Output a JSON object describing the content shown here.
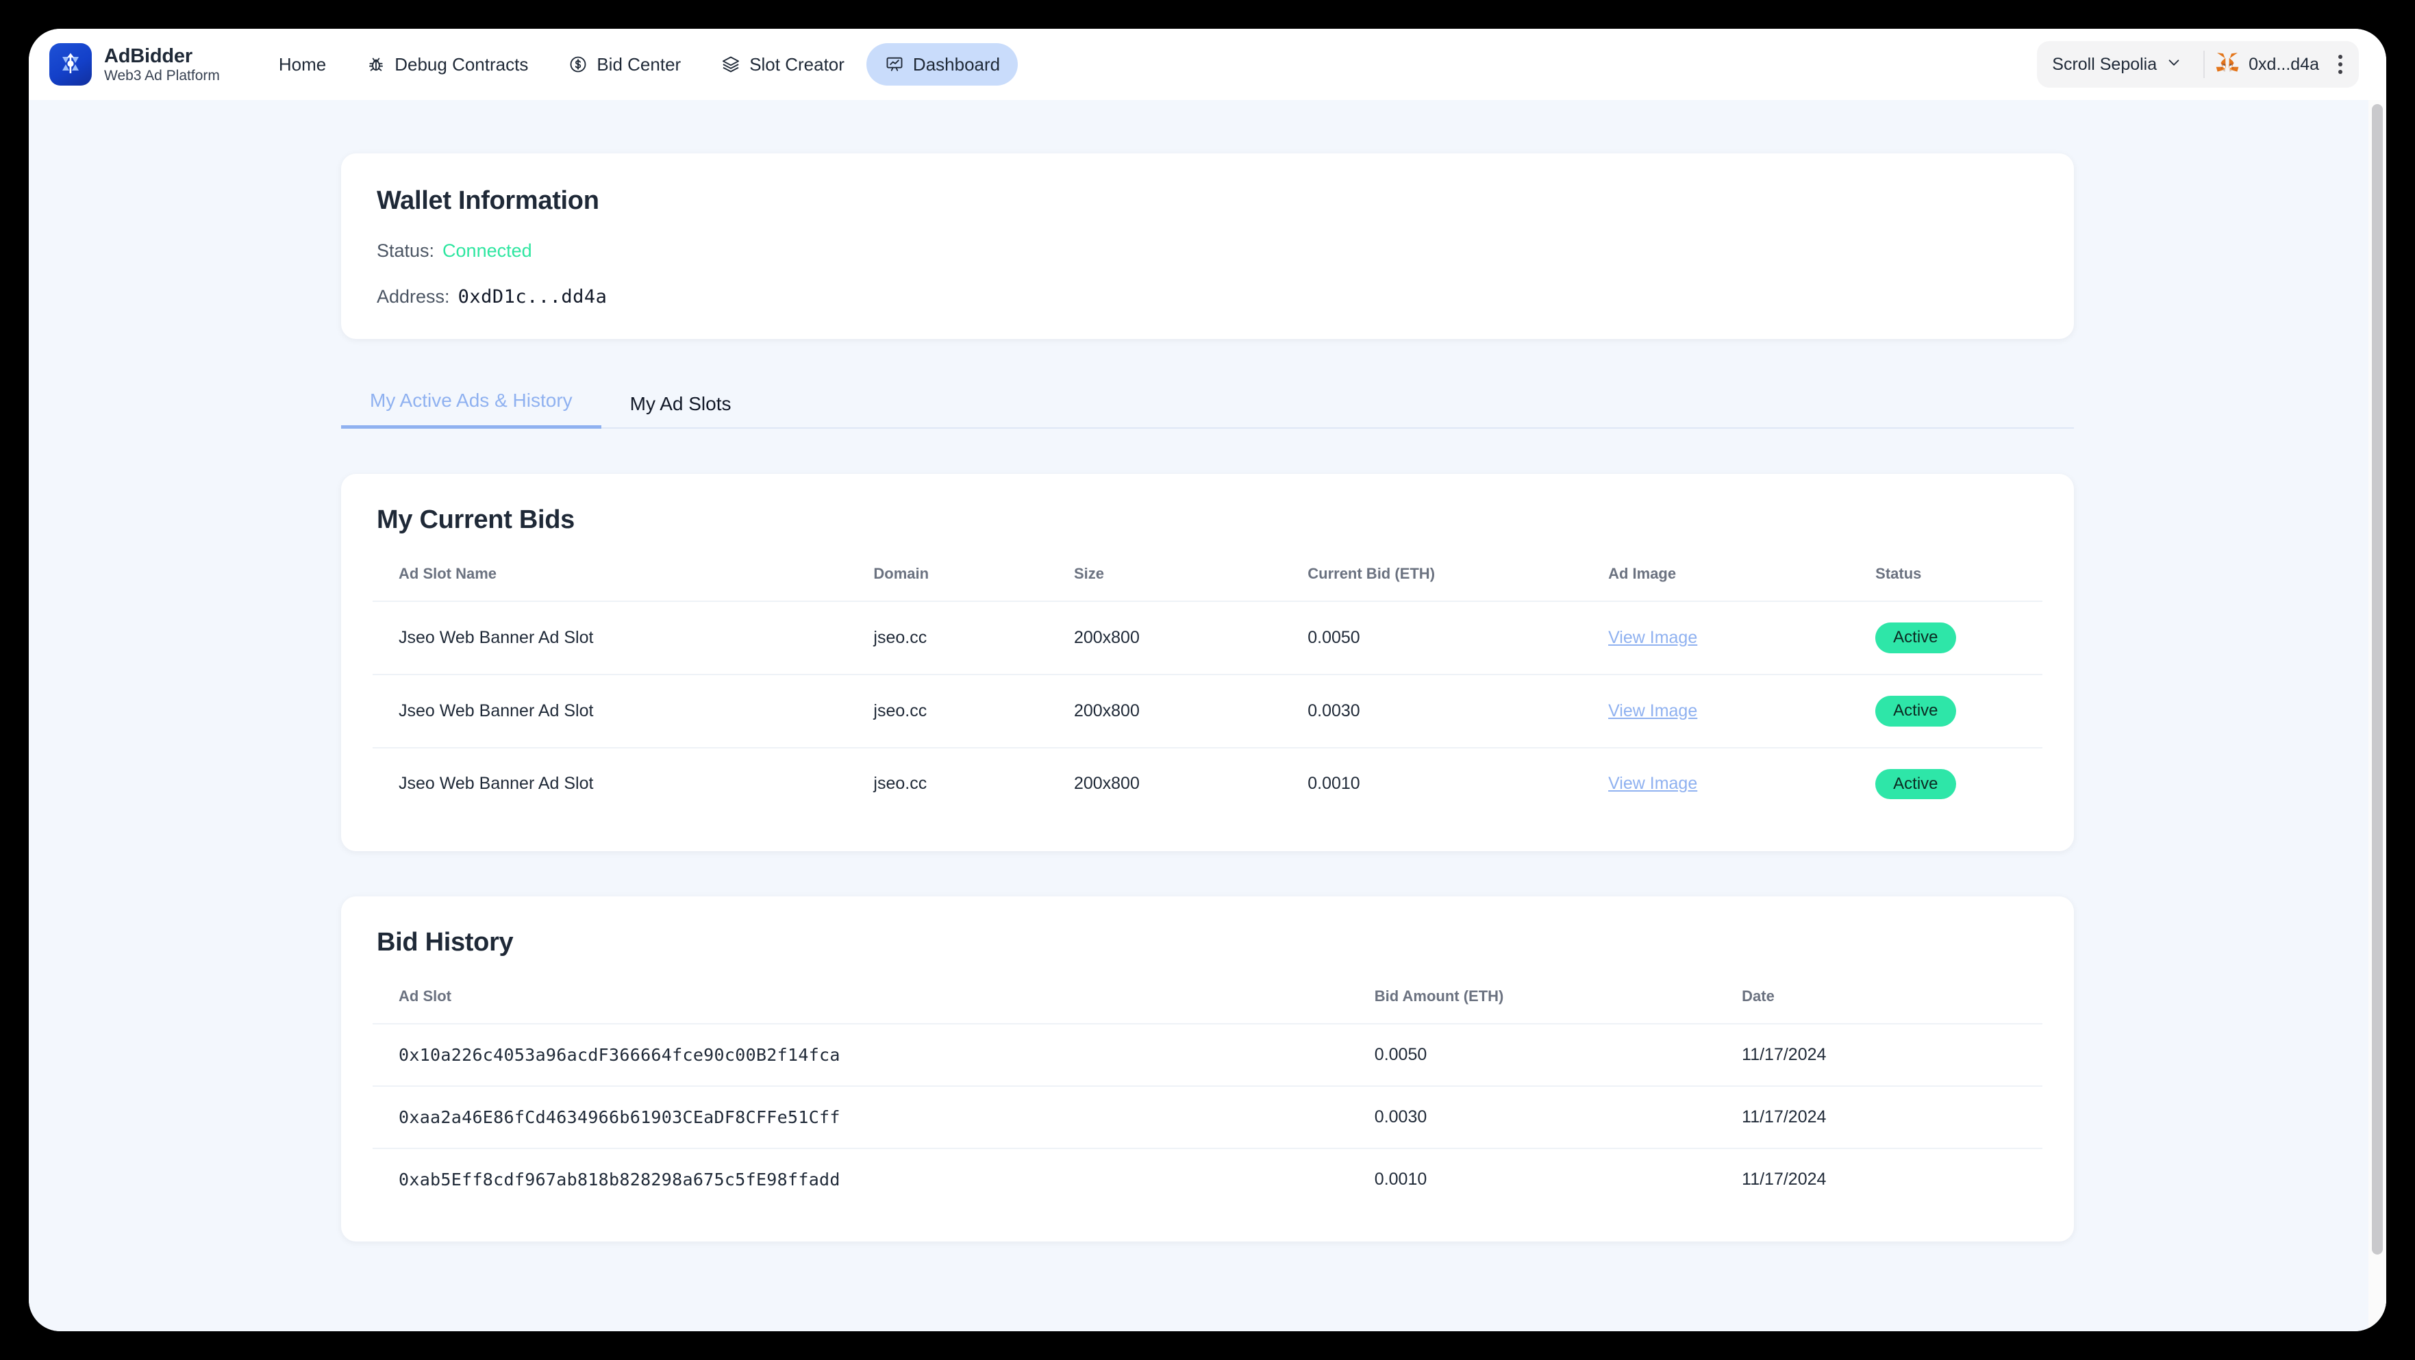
{
  "nav": {
    "brand": {
      "name": "AdBidder",
      "subtitle": "Web3 Ad Platform",
      "logo_icon": "adbidder-logo-icon"
    },
    "links": [
      {
        "label": "Home",
        "icon": "",
        "active": false
      },
      {
        "label": "Debug Contracts",
        "icon": "bug-icon",
        "active": false
      },
      {
        "label": "Bid Center",
        "icon": "dollar-circle-icon",
        "active": false
      },
      {
        "label": "Slot Creator",
        "icon": "layers-icon",
        "active": false
      },
      {
        "label": "Dashboard",
        "icon": "presentation-chart-icon",
        "active": true
      }
    ],
    "network": {
      "label": "Scroll Sepolia",
      "chevron_icon": "chevron-down-icon"
    },
    "account": {
      "label": "0xd...d4a",
      "wallet_icon": "metamask-fox-icon"
    },
    "menu_icon": "kebab-menu-icon"
  },
  "wallet_card": {
    "title": "Wallet Information",
    "status_label": "Status:",
    "status_value": "Connected",
    "address_label": "Address:",
    "address_value": "0xdD1c...dd4a"
  },
  "tabs": [
    {
      "label": "My Active Ads & History",
      "active": true
    },
    {
      "label": "My Ad Slots",
      "active": false
    }
  ],
  "current_bids": {
    "title": "My Current Bids",
    "columns": [
      "Ad Slot Name",
      "Domain",
      "Size",
      "Current Bid (ETH)",
      "Ad Image",
      "Status"
    ],
    "rows": [
      {
        "name": "Jseo Web Banner Ad Slot",
        "domain": "jseo.cc",
        "size": "200x800",
        "bid": "0.0050",
        "image_link": "View Image",
        "status": "Active"
      },
      {
        "name": "Jseo Web Banner Ad Slot",
        "domain": "jseo.cc",
        "size": "200x800",
        "bid": "0.0030",
        "image_link": "View Image",
        "status": "Active"
      },
      {
        "name": "Jseo Web Banner Ad Slot",
        "domain": "jseo.cc",
        "size": "200x800",
        "bid": "0.0010",
        "image_link": "View Image",
        "status": "Active"
      }
    ]
  },
  "bid_history": {
    "title": "Bid History",
    "columns": [
      "Ad Slot",
      "Bid Amount (ETH)",
      "Date"
    ],
    "rows": [
      {
        "slot": "0x10a226c4053a96acdF366664fce90c00B2f14fca",
        "amount": "0.0050",
        "date": "11/17/2024"
      },
      {
        "slot": "0xaa2a46E86fCd4634966b61903CEaDF8CFFe51Cff",
        "amount": "0.0030",
        "date": "11/17/2024"
      },
      {
        "slot": "0xab5Eff8cdf967ab818b828298a675c5fE98ffadd",
        "amount": "0.0010",
        "date": "11/17/2024"
      }
    ]
  },
  "colors": {
    "accent_blue": "#1e51d6",
    "tab_active": "#8fb1f0",
    "status_green": "#2ee6a0",
    "badge_green": "#2ee6a8",
    "page_bg": "#f3f7fd"
  }
}
